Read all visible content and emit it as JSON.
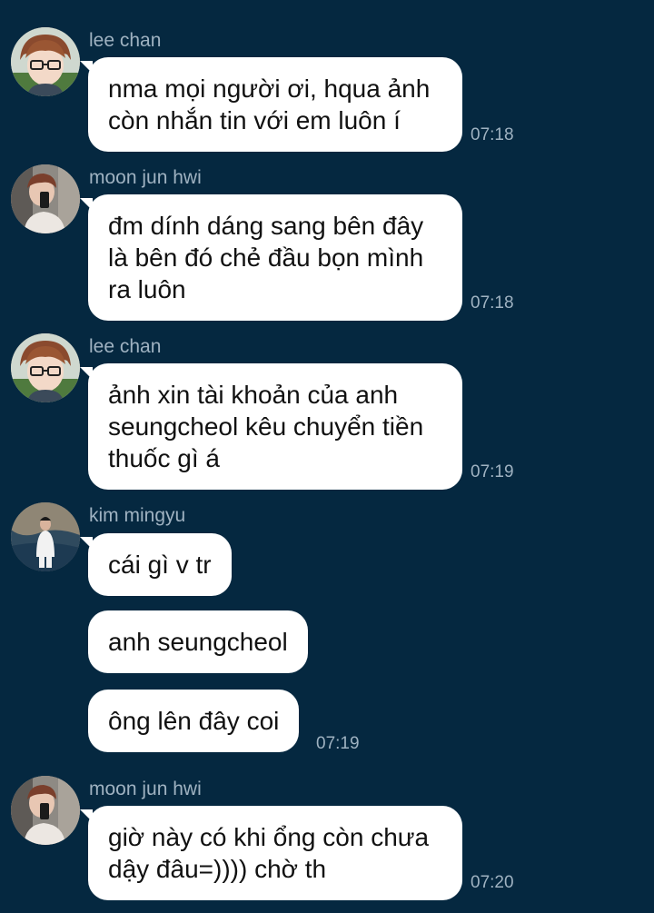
{
  "messages": [
    {
      "sender": "lee chan",
      "text": "nma mọi người ơi, hqua ảnh còn nhắn tin với em luôn í",
      "time": "07:18",
      "avatar": "lee-chan-avatar"
    },
    {
      "sender": "moon jun hwi",
      "text": "đm dính dáng sang bên đây là bên đó chẻ đầu bọn mình ra luôn",
      "time": "07:18",
      "avatar": "moon-jun-hwi-avatar"
    },
    {
      "sender": "lee chan",
      "text": "ảnh xin tài khoản của anh seungcheol kêu chuyển tiền thuốc gì á",
      "time": "07:19",
      "avatar": "lee-chan-avatar"
    },
    {
      "sender": "kim mingyu",
      "text": "cái gì v tr",
      "avatar": "kim-mingyu-avatar"
    },
    {
      "sender": "kim mingyu",
      "text": "anh seungcheol"
    },
    {
      "sender": "kim mingyu",
      "text": "ông lên đây coi",
      "time": "07:19"
    },
    {
      "sender": "moon jun hwi",
      "text": "giờ này có khi ổng còn chưa dậy đâu=)))) chờ th",
      "time": "07:20",
      "avatar": "moon-jun-hwi-avatar"
    }
  ],
  "colors": {
    "background": "#052840",
    "bubble": "#ffffff",
    "meta_text": "#9fb2c1"
  }
}
